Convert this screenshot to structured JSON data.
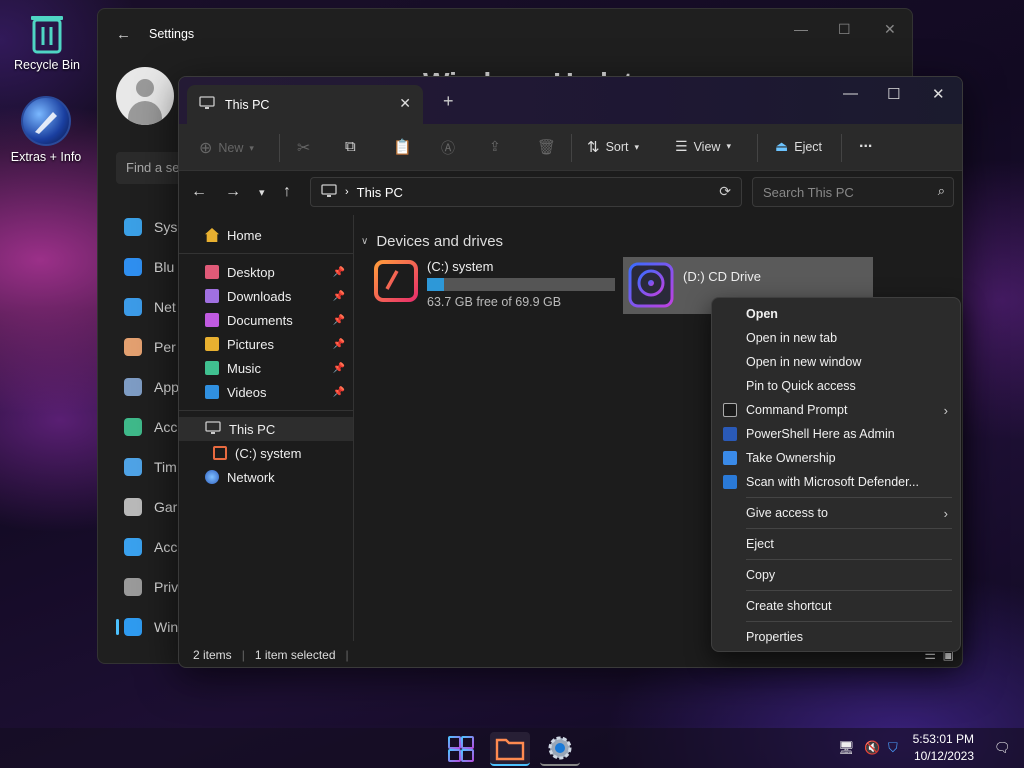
{
  "desktop": {
    "icons": [
      {
        "label": "Recycle Bin",
        "icon": "recycle-bin-icon"
      },
      {
        "label": "Extras + Info",
        "icon": "extras-info-icon"
      }
    ]
  },
  "settings": {
    "title": "Settings",
    "heading": "Windows Update",
    "search_placeholder": "Find a se",
    "nav": [
      {
        "label": "Sys",
        "icon": "system-icon",
        "color": "#3ba0e6"
      },
      {
        "label": "Blu",
        "icon": "bluetooth-icon",
        "color": "#2f8ff0"
      },
      {
        "label": "Net",
        "icon": "wifi-icon",
        "color": "#3c9be8"
      },
      {
        "label": "Per",
        "icon": "brush-icon",
        "color": "#e3a070"
      },
      {
        "label": "App",
        "icon": "apps-icon",
        "color": "#7e9cc4"
      },
      {
        "label": "Acc",
        "icon": "account-icon",
        "color": "#3fb98a"
      },
      {
        "label": "Tim",
        "icon": "time-icon",
        "color": "#4fa3e6"
      },
      {
        "label": "Gar",
        "icon": "gaming-icon",
        "color": "#b9b9b9"
      },
      {
        "label": "Acc",
        "icon": "accessibility-icon",
        "color": "#3aa1ee"
      },
      {
        "label": "Priv",
        "icon": "shield-icon",
        "color": "#9a9a9a"
      },
      {
        "label": "Win",
        "icon": "update-icon",
        "color": "#2f9bf0"
      }
    ]
  },
  "explorer": {
    "tab_title": "This PC",
    "toolbar": {
      "new": "New",
      "sort": "Sort",
      "view": "View",
      "eject": "Eject",
      "more": "..."
    },
    "address": {
      "path": "This PC",
      "search_placeholder": "Search This PC"
    },
    "nav": {
      "home": "Home",
      "pinned": [
        {
          "label": "Desktop",
          "icon": "desktop-icon",
          "color": "#e05a78"
        },
        {
          "label": "Downloads",
          "icon": "downloads-icon",
          "color": "#a070e0"
        },
        {
          "label": "Documents",
          "icon": "documents-icon",
          "color": "#c05ae0"
        },
        {
          "label": "Pictures",
          "icon": "pictures-icon",
          "color": "#e8b030"
        },
        {
          "label": "Music",
          "icon": "music-icon",
          "color": "#40c090"
        },
        {
          "label": "Videos",
          "icon": "videos-icon",
          "color": "#3090e0"
        }
      ],
      "this_pc": "This PC",
      "c_drive": "(C:) system",
      "network": "Network"
    },
    "content": {
      "group": "Devices and drives",
      "drives": [
        {
          "name": "(C:) system",
          "free": "63.7 GB free of 69.9 GB",
          "used_fraction": 0.09
        },
        {
          "name": "(D:) CD Drive"
        }
      ]
    },
    "status": {
      "items": "2 items",
      "selected": "1 item selected"
    }
  },
  "context_menu": {
    "items": [
      {
        "label": "Open",
        "bold": true
      },
      {
        "label": "Open in new tab"
      },
      {
        "label": "Open in new window"
      },
      {
        "label": "Pin to Quick access"
      },
      {
        "label": "Command Prompt",
        "icon": "cmd-icon",
        "submenu": true
      },
      {
        "label": "PowerShell Here as Admin",
        "icon": "powershell-icon"
      },
      {
        "label": "Take Ownership",
        "icon": "ownership-shield-icon"
      },
      {
        "label": "Scan with Microsoft Defender...",
        "icon": "defender-icon"
      },
      {
        "label": "Give access to",
        "submenu": true,
        "sep_before": true
      },
      {
        "label": "Eject",
        "sep_before": true
      },
      {
        "label": "Copy",
        "sep_before": true
      },
      {
        "label": "Create shortcut",
        "sep_before": true
      },
      {
        "label": "Properties",
        "sep_before": true
      }
    ]
  },
  "taskbar": {
    "time": "5:53:01 PM",
    "date": "10/12/2023"
  }
}
